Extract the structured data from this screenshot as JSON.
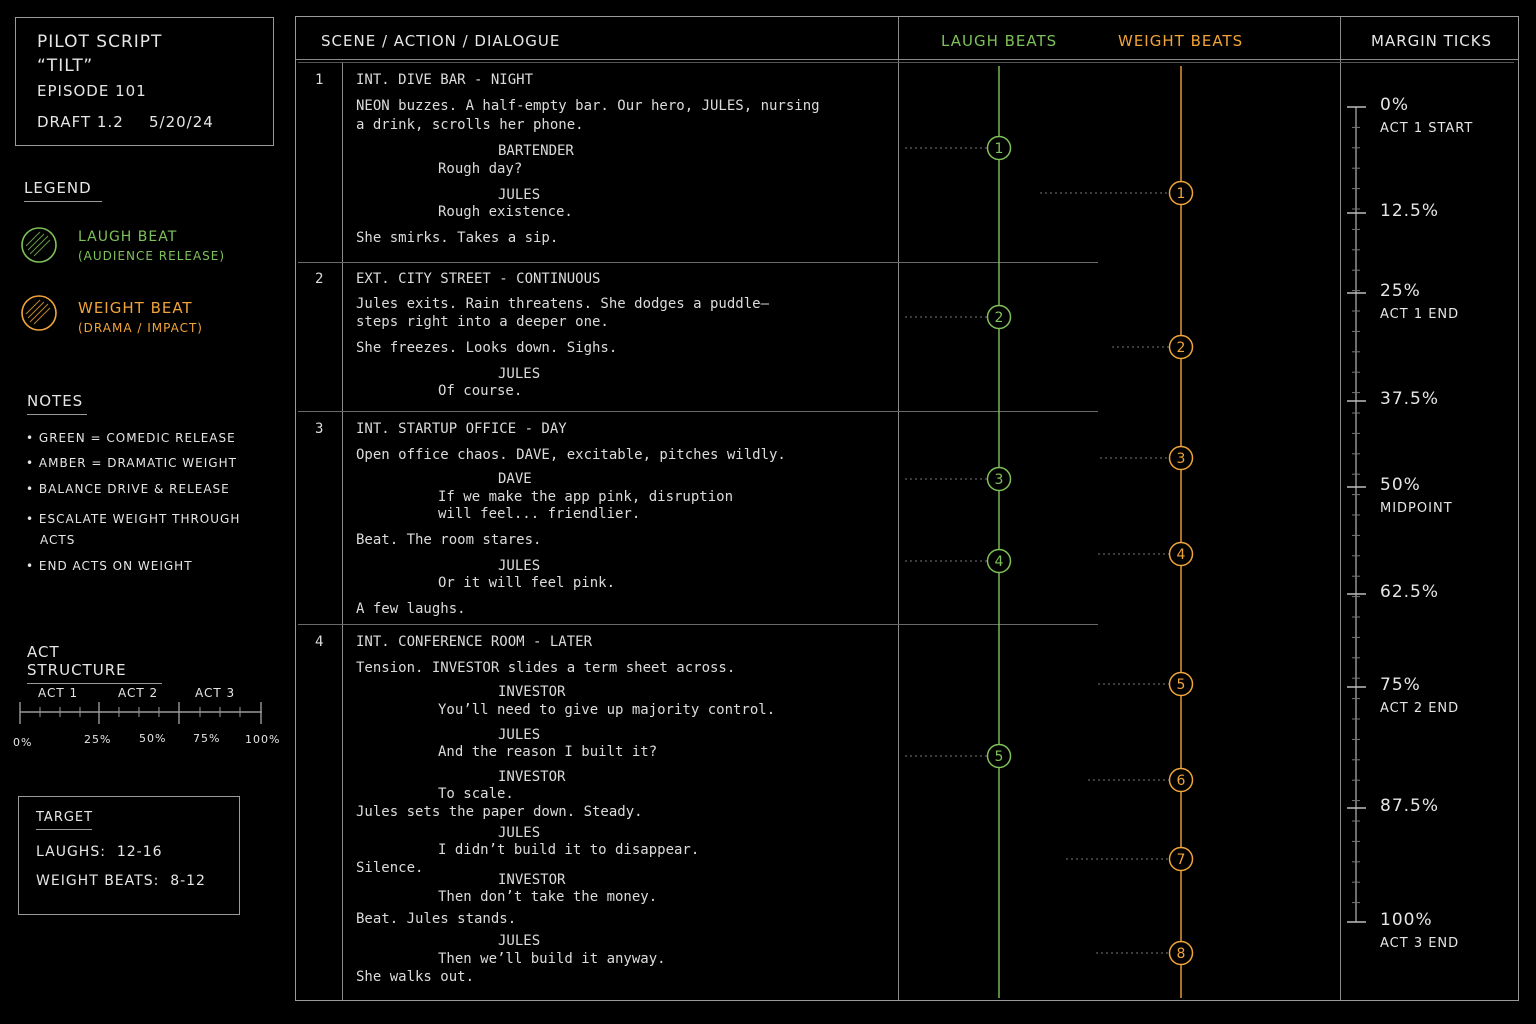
{
  "title_block": {
    "line1": "PILOT SCRIPT",
    "line2": "“TILT”",
    "episode": "EPISODE 101",
    "draft": "DRAFT 1.2",
    "date": "5/20/24"
  },
  "legend": {
    "heading": "LEGEND",
    "laugh_title": "LAUGH BEAT",
    "laugh_sub": "(AUDIENCE RELEASE)",
    "weight_title": "WEIGHT BEAT",
    "weight_sub": "(DRAMA / IMPACT)"
  },
  "notes": {
    "heading": "NOTES",
    "items": [
      "GREEN = COMEDIC RELEASE",
      "AMBER = DRAMATIC WEIGHT",
      "BALANCE DRIVE & RELEASE",
      "ESCALATE WEIGHT THROUGH",
      "ACTS",
      "END ACTS ON WEIGHT"
    ]
  },
  "act_structure": {
    "heading": "ACT STRUCTURE",
    "acts": [
      "ACT 1",
      "ACT 2",
      "ACT 3"
    ],
    "ticks": [
      "0%",
      "25%",
      "50%",
      "75%",
      "100%"
    ]
  },
  "target": {
    "heading": "TARGET",
    "laughs": "LAUGHS:  12-16",
    "weight": "WEIGHT BEATS:  8-12"
  },
  "header": {
    "col1": "SCENE / ACTION / DIALOGUE",
    "laugh": "LAUGH BEATS",
    "weight": "WEIGHT BEATS",
    "ticks": "MARGIN TICKS"
  },
  "scenes": [
    {
      "num": "1",
      "heading": "INT. DIVE BAR - NIGHT",
      "lines": [
        "NEON buzzes. A half-empty bar. Our hero, JULES, nursing",
        "a drink, scrolls her phone.",
        "BARTENDER",
        "Rough day?",
        "JULES",
        "Rough existence.",
        "She smirks. Takes a sip."
      ]
    },
    {
      "num": "2",
      "heading": "EXT. CITY STREET - CONTINUOUS",
      "lines": [
        "Jules exits. Rain threatens. She dodges a puddle—",
        "steps right into a deeper one.",
        "She freezes. Looks down. Sighs.",
        "JULES",
        "Of course."
      ]
    },
    {
      "num": "3",
      "heading": "INT. STARTUP OFFICE - DAY",
      "lines": [
        "Open office chaos. DAVE, excitable, pitches wildly.",
        "DAVE",
        "If we make the app pink, disruption",
        "will feel... friendlier.",
        "Beat. The room stares.",
        "JULES",
        "Or it will feel pink.",
        "A few laughs."
      ]
    },
    {
      "num": "4",
      "heading": "INT. CONFERENCE ROOM - LATER",
      "lines": [
        "Tension. INVESTOR slides a term sheet across.",
        "INVESTOR",
        "You’ll need to give up majority control.",
        "JULES",
        "And the reason I built it?",
        "INVESTOR",
        "To scale.",
        "Jules sets the paper down. Steady.",
        "JULES",
        "I didn’t build it to disappear.",
        "Silence.",
        "INVESTOR",
        "Then don’t take the money.",
        "Beat. Jules stands.",
        "JULES",
        "Then we’ll build it anyway.",
        "She walks out."
      ]
    }
  ],
  "laugh_beats": [
    "1",
    "2",
    "3",
    "4",
    "5"
  ],
  "weight_beats": [
    "1",
    "2",
    "3",
    "4",
    "5",
    "6",
    "7",
    "8"
  ],
  "margin_ticks": [
    {
      "pct": "0%",
      "label": "ACT 1 START"
    },
    {
      "pct": "12.5%",
      "label": ""
    },
    {
      "pct": "25%",
      "label": "ACT 1 END"
    },
    {
      "pct": "37.5%",
      "label": ""
    },
    {
      "pct": "50%",
      "label": "MIDPOINT"
    },
    {
      "pct": "62.5%",
      "label": ""
    },
    {
      "pct": "75%",
      "label": "ACT 2 END"
    },
    {
      "pct": "87.5%",
      "label": ""
    },
    {
      "pct": "100%",
      "label": "ACT 3 END"
    }
  ],
  "colors": {
    "laugh": "#7fc15a",
    "weight": "#f0a43a",
    "line": "#9a9a9a"
  }
}
